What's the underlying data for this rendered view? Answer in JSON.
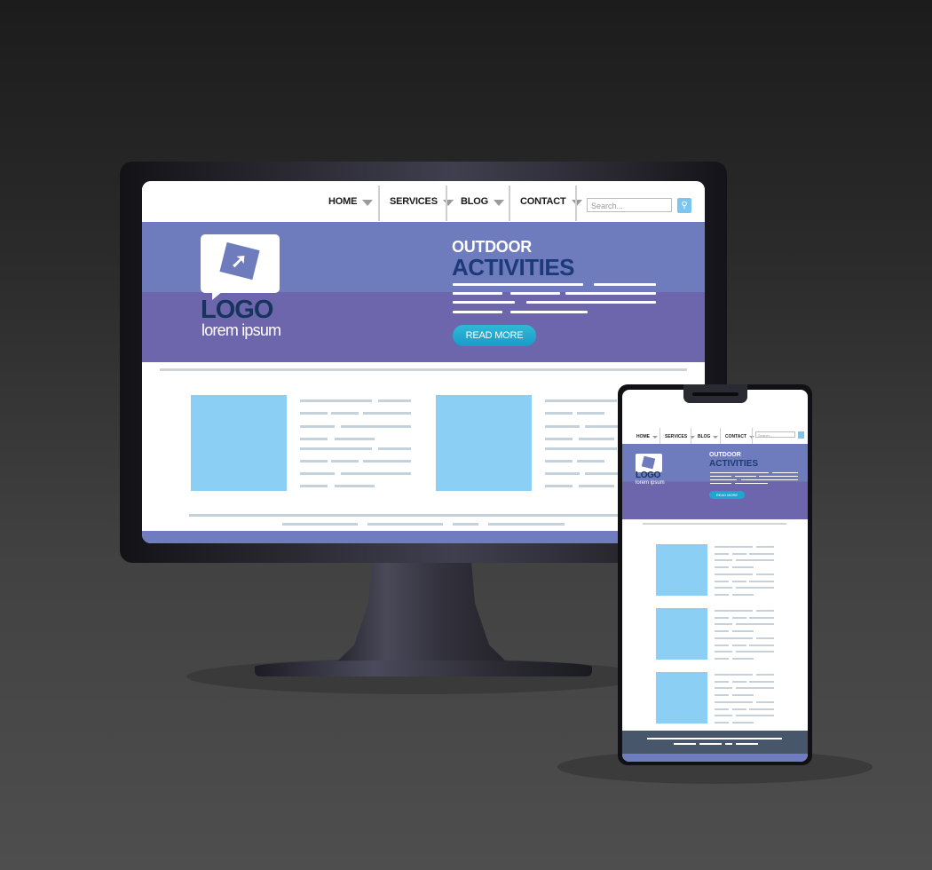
{
  "desktop": {
    "nav": {
      "items": [
        {
          "label": "HOME"
        },
        {
          "label": "SERVICES"
        },
        {
          "label": "BLOG"
        },
        {
          "label": "CONTACT"
        }
      ],
      "search_placeholder": "Search...",
      "search_icon": "key-search-icon"
    },
    "hero": {
      "logo_text": "LOGO",
      "logo_subtext": "lorem ipsum",
      "logo_icon": "cursor-arrow-icon",
      "supertitle": "OUTDOOR",
      "title": "ACTIVITIES",
      "button_label": "READ MORE"
    },
    "content": {
      "cards": [
        {
          "image": "image-placeholder"
        },
        {
          "image": "image-placeholder"
        }
      ]
    }
  },
  "phone": {
    "nav": {
      "items": [
        {
          "label": "HOME"
        },
        {
          "label": "SERVICES"
        },
        {
          "label": "BLOG"
        },
        {
          "label": "CONTACT"
        }
      ],
      "search_placeholder": "Search..."
    },
    "hero": {
      "logo_text": "LOGO",
      "logo_subtext": "lorem ipsum",
      "supertitle": "OUTDOOR",
      "title": "ACTIVITIES",
      "button_label": "READ MORE"
    },
    "content": {
      "cards": [
        {
          "image": "image-placeholder"
        },
        {
          "image": "image-placeholder"
        },
        {
          "image": "image-placeholder"
        }
      ]
    }
  },
  "colors": {
    "hero_top": "#6e7bbc",
    "hero_bottom": "#6d66ac",
    "title_navy": "#1c3a78",
    "button_cyan": "#1a9bc9",
    "image_placeholder": "#8ccff5",
    "phone_footer": "#48566b"
  }
}
